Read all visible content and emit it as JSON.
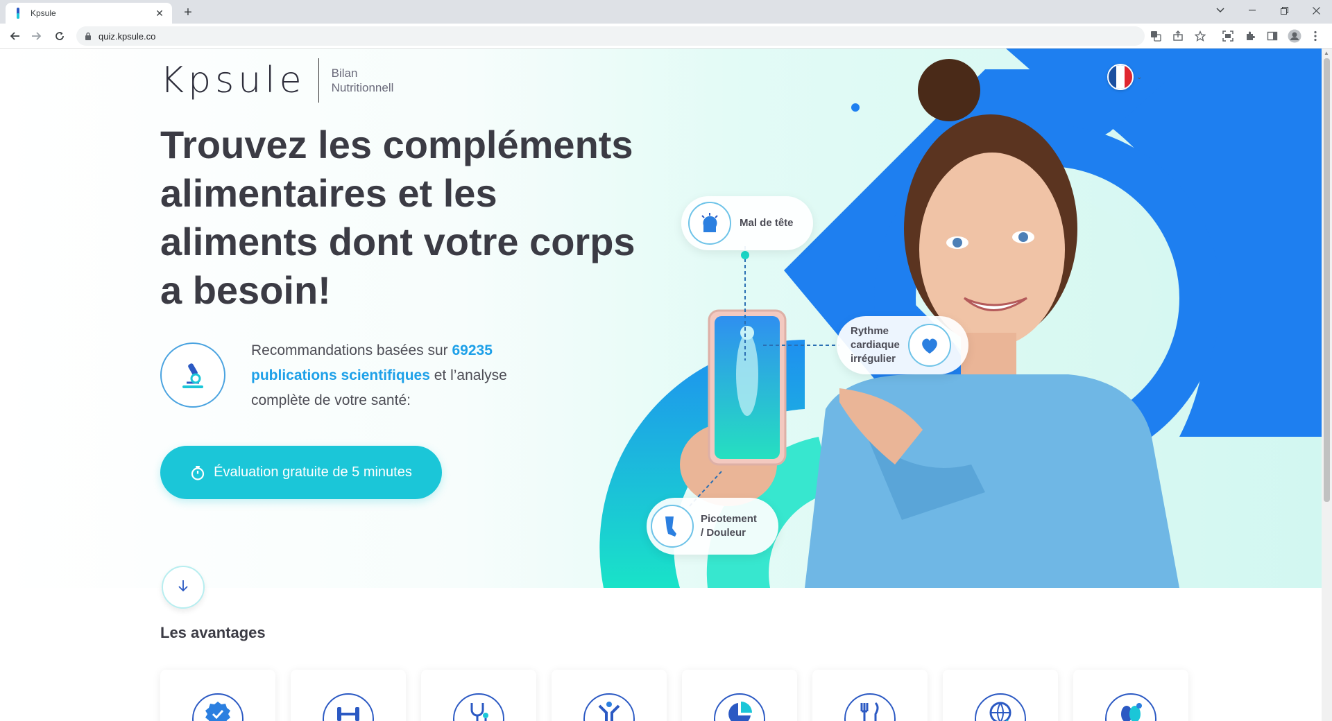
{
  "browser": {
    "tab_title": "Kpsule",
    "url": "quiz.kpsule.co"
  },
  "header": {
    "logo_text": "Kpsule",
    "logo_subtitle_line1": "Bilan",
    "logo_subtitle_line2": "Nutritionnell",
    "language": "fr"
  },
  "hero": {
    "title": "Trouvez les compléments alimentaires et les aliments dont votre corps a besoin!",
    "desc_prefix": "Recommandations basées sur ",
    "desc_highlight": "69235 publications scientifiques",
    "desc_suffix": " et l’analyse complète de votre santé:",
    "cta_label": "Évaluation gratuite de 5 minutes",
    "symptoms": {
      "headache": "Mal de tête",
      "heart_line1": "Rythme",
      "heart_line2": "cardiaque",
      "heart_line3": "irrégulier",
      "pain_line1": "Picotement",
      "pain_line2": "/ Douleur"
    }
  },
  "advantages": {
    "title": "Les avantages",
    "icons": [
      "badge-check-icon",
      "dumbbell-icon",
      "stethoscope-icon",
      "person-arms-up-icon",
      "pie-chart-icon",
      "fork-knife-icon",
      "globe-icon",
      "organs-icon"
    ]
  },
  "colors": {
    "accent_cyan": "#1bc6d8",
    "accent_blue": "#1da0e8",
    "deco_blue": "#1e7ff0",
    "deco_teal": "#19d9c8",
    "title_text": "#3b3b44"
  }
}
